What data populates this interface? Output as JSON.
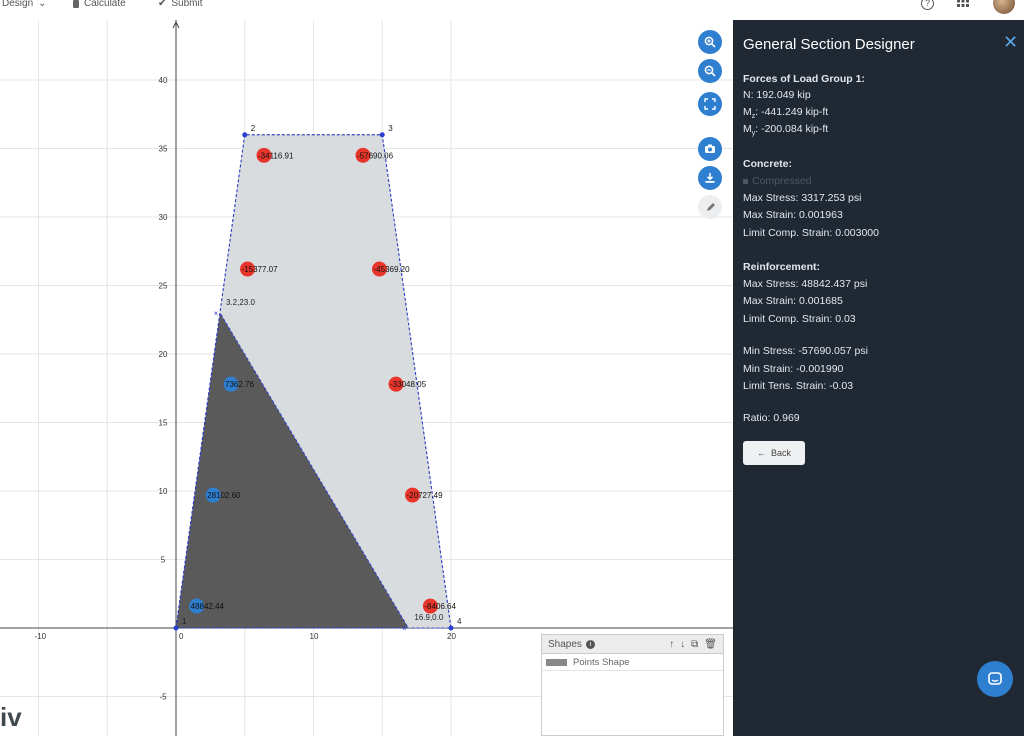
{
  "topbar": {
    "design_label": "Design",
    "calculate_label": "Calculate",
    "submit_label": "Submit",
    "help_glyph": "?",
    "apps_glyph": "⋮⋮⋮"
  },
  "chart_data": {
    "type": "scatter",
    "xlim": [
      -13,
      23
    ],
    "ylim": [
      -8,
      44
    ],
    "x_ticks": [
      -10,
      0,
      10,
      20
    ],
    "y_ticks": [
      -5,
      5,
      10,
      15,
      20,
      25,
      30,
      35,
      40
    ],
    "grid": true,
    "section_vertices": [
      {
        "label": "1",
        "x": 0,
        "y": 0
      },
      {
        "label": "2",
        "x": 5,
        "y": 36
      },
      {
        "label": "3",
        "x": 15,
        "y": 36
      },
      {
        "label": "4",
        "x": 20,
        "y": 0
      }
    ],
    "compression_zone": [
      {
        "x": 0,
        "y": 0
      },
      {
        "x": 3.2,
        "y": 23.0
      },
      {
        "x": 16.9,
        "y": 0.0
      }
    ],
    "compression_zone_labels": [
      {
        "text": "3.2,23.0",
        "x": 3.2,
        "y": 23.0
      },
      {
        "text": "16.9,0.0",
        "x": 16.9,
        "y": 0.0
      }
    ],
    "rebars": [
      {
        "x": 6.4,
        "y": 34.5,
        "value": "-34116.91",
        "kind": "tension"
      },
      {
        "x": 13.6,
        "y": 34.5,
        "value": "-57690.06",
        "kind": "tension"
      },
      {
        "x": 5.2,
        "y": 26.2,
        "value": "-15377.07",
        "kind": "tension"
      },
      {
        "x": 14.8,
        "y": 26.2,
        "value": "-45369.20",
        "kind": "tension"
      },
      {
        "x": 4.0,
        "y": 17.8,
        "value": "7362.76",
        "kind": "compression"
      },
      {
        "x": 16.0,
        "y": 17.8,
        "value": "-33048.05",
        "kind": "tension"
      },
      {
        "x": 2.7,
        "y": 9.7,
        "value": "28102.60",
        "kind": "compression"
      },
      {
        "x": 17.2,
        "y": 9.7,
        "value": "-20727.49",
        "kind": "tension"
      },
      {
        "x": 1.5,
        "y": 1.6,
        "value": "48842.44",
        "kind": "compression"
      },
      {
        "x": 18.5,
        "y": 1.6,
        "value": "-8406.64",
        "kind": "tension"
      }
    ],
    "colors": {
      "tension": "#e8352b",
      "compression": "#2f7fd0",
      "section_fill": "#d5d8db",
      "compression_fill": "#5a5a5a",
      "outline": "#2b3fd1"
    }
  },
  "shapes_panel": {
    "title": "Shapes",
    "items": [
      "Points Shape"
    ]
  },
  "logo_text": "iv",
  "results": {
    "title": "General Section Designer",
    "forces_header": "Forces of Load Group 1:",
    "n": "N: 192.049 kip",
    "mz_prefix": "M",
    "mz_sub": "z",
    "mz_value": ": -441.249 kip-ft",
    "my_prefix": "M",
    "my_sub": "y",
    "my_value": ": -200.084 kip-ft",
    "concrete_header": "Concrete:",
    "concrete_legend": "Compressed",
    "concrete_max_stress": "Max Stress: 3317.253 psi",
    "concrete_max_strain": "Max Strain: 0.001963",
    "concrete_limit": "Limit Comp. Strain: 0.003000",
    "reinf_header": "Reinforcement:",
    "reinf_max_stress": "Max Stress: 48842.437 psi",
    "reinf_max_strain": "Max Strain: 0.001685",
    "reinf_limit_comp": "Limit Comp. Strain: 0.03",
    "reinf_min_stress": "Min Stress: -57690.057 psi",
    "reinf_min_strain": "Min Strain: -0.001990",
    "reinf_limit_tens": "Limit Tens. Strain: -0.03",
    "ratio": "Ratio: 0.969",
    "back_label": "Back"
  }
}
